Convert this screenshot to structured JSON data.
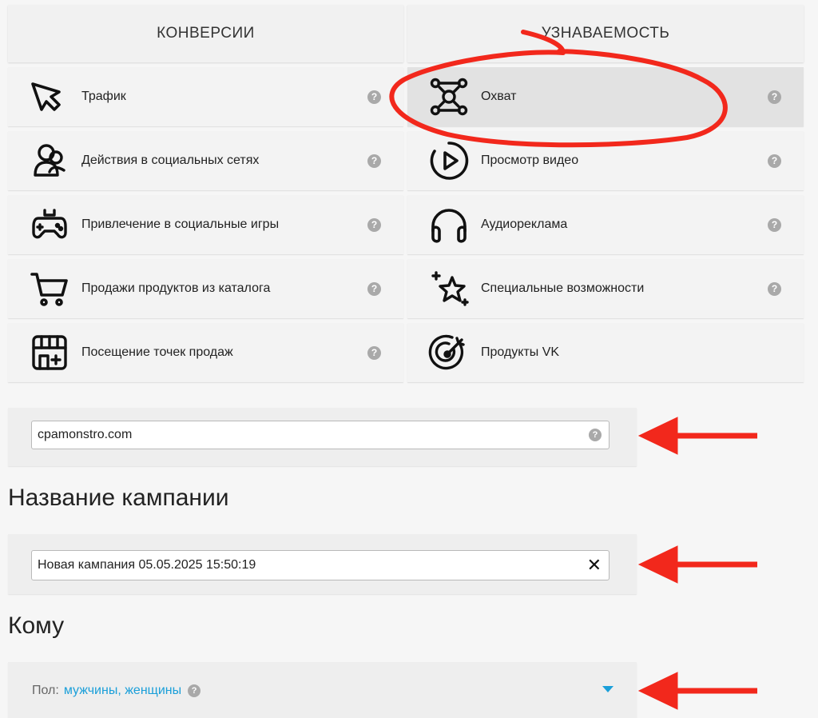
{
  "tabs": {
    "conversions": "КОНВЕРСИИ",
    "awareness": "УЗНАВАЕМОСТЬ"
  },
  "objectives_left": [
    {
      "label": "Трафик",
      "icon": "cursor-click-icon"
    },
    {
      "label": "Действия в социальных сетях",
      "icon": "social-users-icon"
    },
    {
      "label": "Привлечение в социальные игры",
      "icon": "gamepad-icon"
    },
    {
      "label": "Продажи продуктов из каталога",
      "icon": "shopping-cart-icon"
    },
    {
      "label": "Посещение точек продаж",
      "icon": "storefront-icon"
    }
  ],
  "objectives_right": [
    {
      "label": "Охват",
      "icon": "reach-network-icon",
      "selected": true
    },
    {
      "label": "Просмотр видео",
      "icon": "play-video-icon"
    },
    {
      "label": "Аудиореклама",
      "icon": "headphones-icon"
    },
    {
      "label": "Специальные возможности",
      "icon": "sparkle-star-icon"
    },
    {
      "label": "Продукты VK",
      "icon": "target-icon"
    }
  ],
  "help_glyph": "?",
  "site": {
    "value": "cpamonstro.com"
  },
  "campaign": {
    "heading": "Название кампании",
    "value": "Новая кампания 05.05.2025 15:50:19",
    "clear_glyph": "✕"
  },
  "audience": {
    "heading": "Кому",
    "gender_label": "Пол:",
    "gender_value": "мужчины, женщины"
  },
  "colors": {
    "annotation_red": "#f2281c",
    "link_blue": "#1a9fd9",
    "selected_tile": "#e2e2e2"
  }
}
